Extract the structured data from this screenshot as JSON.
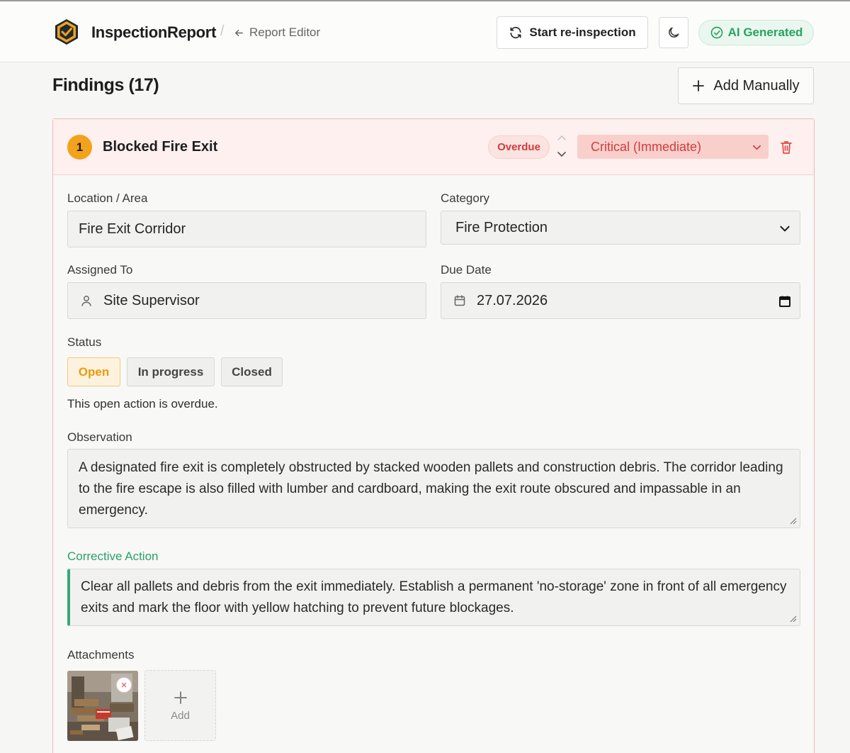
{
  "header": {
    "brand": "InspectionReport",
    "separator": "/",
    "back_label": "Report Editor",
    "reinspect_label": "Start re-inspection",
    "ai_badge": "AI Generated"
  },
  "findings": {
    "title": "Findings (17)",
    "add_manual_label": "Add Manually"
  },
  "finding": {
    "number": "1",
    "title": "Blocked Fire Exit",
    "overdue_badge": "Overdue",
    "severity": "Critical (Immediate)",
    "location_label": "Location / Area",
    "location_value": "Fire Exit Corridor",
    "category_label": "Category",
    "category_value": "Fire Protection",
    "assigned_label": "Assigned To",
    "assigned_value": "Site Supervisor",
    "due_label": "Due Date",
    "due_value": "27.07.2026",
    "status_label": "Status",
    "status_options": [
      "Open",
      "In progress",
      "Closed"
    ],
    "status_selected": "Open",
    "overdue_note": "This open action is overdue.",
    "observation_label": "Observation",
    "observation_text": "A designated fire exit is completely obstructed by stacked wooden pallets and construction debris. The corridor leading to the fire escape is also filled with lumber and cardboard, making the exit route obscured and impassable in an emergency.",
    "corrective_label": "Corrective Action",
    "corrective_text": "Clear all pallets and debris from the exit immediately. Establish a permanent 'no-storage' zone in front of all emergency exits and mark the floor with yellow hatching to prevent future blockages.",
    "attachments_label": "Attachments",
    "add_attachment_label": "Add",
    "remove_attachment_label": "×"
  },
  "colors": {
    "accent_orange": "#f2a21b",
    "overdue_red": "#cf3d3a",
    "critical_bg": "#f9cfcc",
    "ai_green": "#27a35f",
    "corrective_green": "#2aa16a"
  }
}
